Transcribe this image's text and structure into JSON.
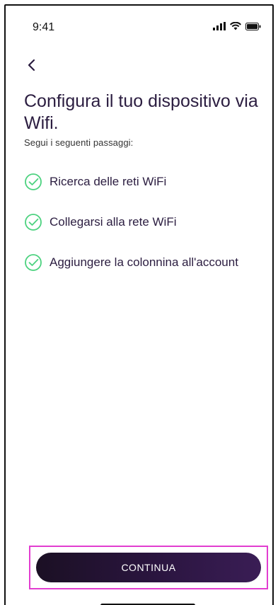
{
  "status_bar": {
    "time": "9:41",
    "icons": [
      "signal-icon",
      "wifi-icon",
      "battery-icon"
    ]
  },
  "nav": {
    "back_icon": "chevron-left-icon"
  },
  "header": {
    "title": "Configura il tuo dispositivo via Wifi.",
    "subtitle": "Segui i seguenti passaggi:"
  },
  "steps": [
    {
      "label": "Ricerca delle reti WiFi",
      "icon": "check-circle-icon"
    },
    {
      "label": "Collegarsi alla rete WiFi",
      "icon": "check-circle-icon"
    },
    {
      "label": "Aggiungere la colonnina all'account",
      "icon": "check-circle-icon"
    }
  ],
  "footer": {
    "continue_label": "CONTINUA"
  },
  "colors": {
    "accent_green": "#4cd27f",
    "title_text": "#2b1d40",
    "button_dark": "#2b1540",
    "highlight_border": "#e23dd0"
  }
}
